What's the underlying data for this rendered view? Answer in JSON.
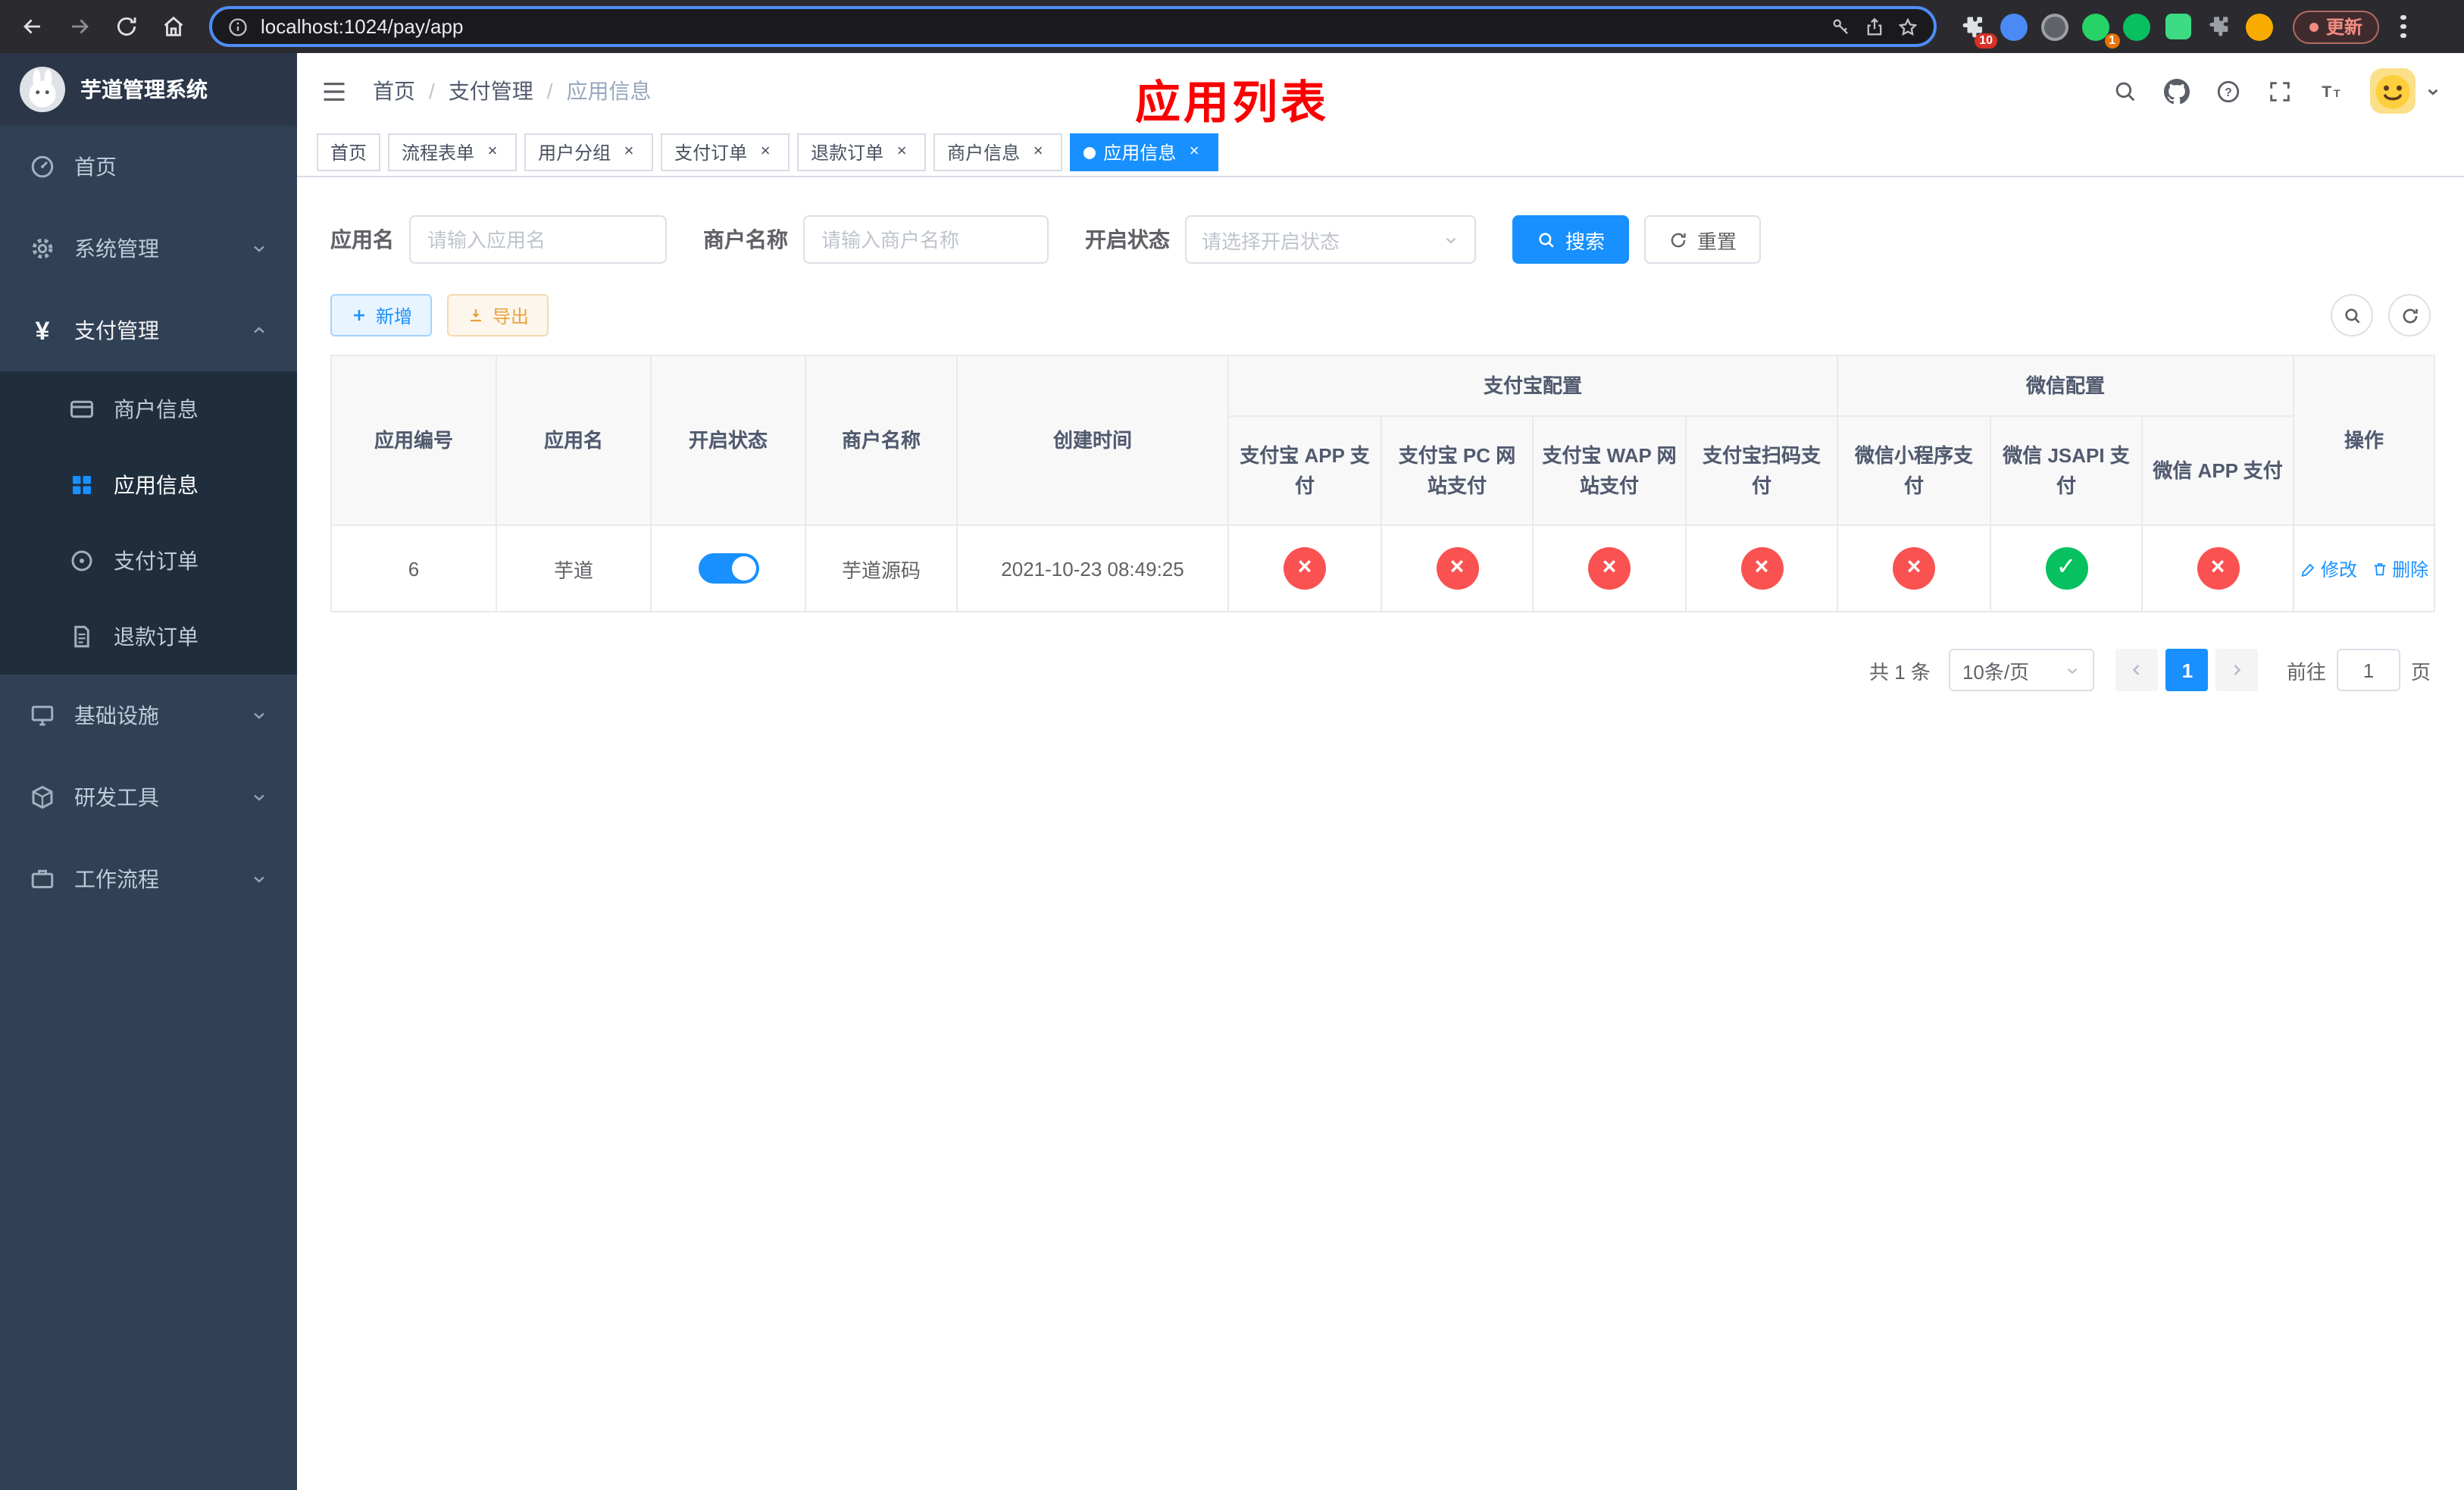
{
  "browser": {
    "url": "localhost:1024/pay/app",
    "update_button": "更新",
    "extensions_badge": "10",
    "extension_badge_green": "1"
  },
  "icons": {
    "check": "✓",
    "cross": "×",
    "close": "×",
    "breadcrumb_separator": "/",
    "yen": "¥"
  },
  "colors": {
    "primary": "#1890ff",
    "status_on": "#07c160",
    "status_off": "#fa5151",
    "heading_red": "#fb0000",
    "warning": "#e6a23c",
    "sidebar_bg": "#304156",
    "submenu_bg": "#1f2d3d"
  },
  "sidebar": {
    "app_title": "芋道管理系统",
    "menu": [
      {
        "label": "首页"
      },
      {
        "label": "系统管理"
      },
      {
        "label": "支付管理"
      },
      {
        "label": "基础设施"
      },
      {
        "label": "研发工具"
      },
      {
        "label": "工作流程"
      }
    ],
    "payment_submenu": [
      {
        "label": "商户信息"
      },
      {
        "label": "应用信息"
      },
      {
        "label": "支付订单"
      },
      {
        "label": "退款订单"
      }
    ]
  },
  "header": {
    "breadcrumb": [
      "首页",
      "支付管理",
      "应用信息"
    ],
    "page_heading": "应用列表"
  },
  "tags": [
    "首页",
    "流程表单",
    "用户分组",
    "支付订单",
    "退款订单",
    "商户信息",
    "应用信息"
  ],
  "filters": {
    "app_name_label": "应用名",
    "app_name_placeholder": "请输入应用名",
    "merchant_name_label": "商户名称",
    "merchant_name_placeholder": "请输入商户名称",
    "status_label": "开启状态",
    "status_placeholder": "请选择开启状态",
    "search_button": "搜索",
    "reset_button": "重置"
  },
  "toolbar": {
    "add_button": "新增",
    "export_button": "导出"
  },
  "table": {
    "headers": {
      "app_id": "应用编号",
      "app_name": "应用名",
      "status": "开启状态",
      "merchant_name": "商户名称",
      "create_time": "创建时间",
      "alipay_group": "支付宝配置",
      "wechat_group": "微信配置",
      "alipay_app": "支付宝 APP 支付",
      "alipay_pc": "支付宝 PC 网站支付",
      "alipay_wap": "支付宝 WAP 网站支付",
      "alipay_qr": "支付宝扫码支付",
      "wechat_lite": "微信小程序支付",
      "wechat_jsapi": "微信 JSAPI 支付",
      "wechat_app": "微信 APP 支付",
      "actions": "操作"
    },
    "rows": [
      {
        "app_id": "6",
        "app_name": "芋道",
        "enabled": true,
        "merchant_name": "芋道源码",
        "create_time": "2021-10-23 08:49:25",
        "alipay_app": false,
        "alipay_pc": false,
        "alipay_wap": false,
        "alipay_qr": false,
        "wechat_lite": false,
        "wechat_jsapi": true,
        "wechat_app": false,
        "edit_label": "修改",
        "delete_label": "删除"
      }
    ]
  },
  "pagination": {
    "total_text": "共 1 条",
    "page_size": "10条/页",
    "current_page": "1",
    "goto_prefix": "前往",
    "goto_value": "1",
    "goto_suffix": "页"
  }
}
